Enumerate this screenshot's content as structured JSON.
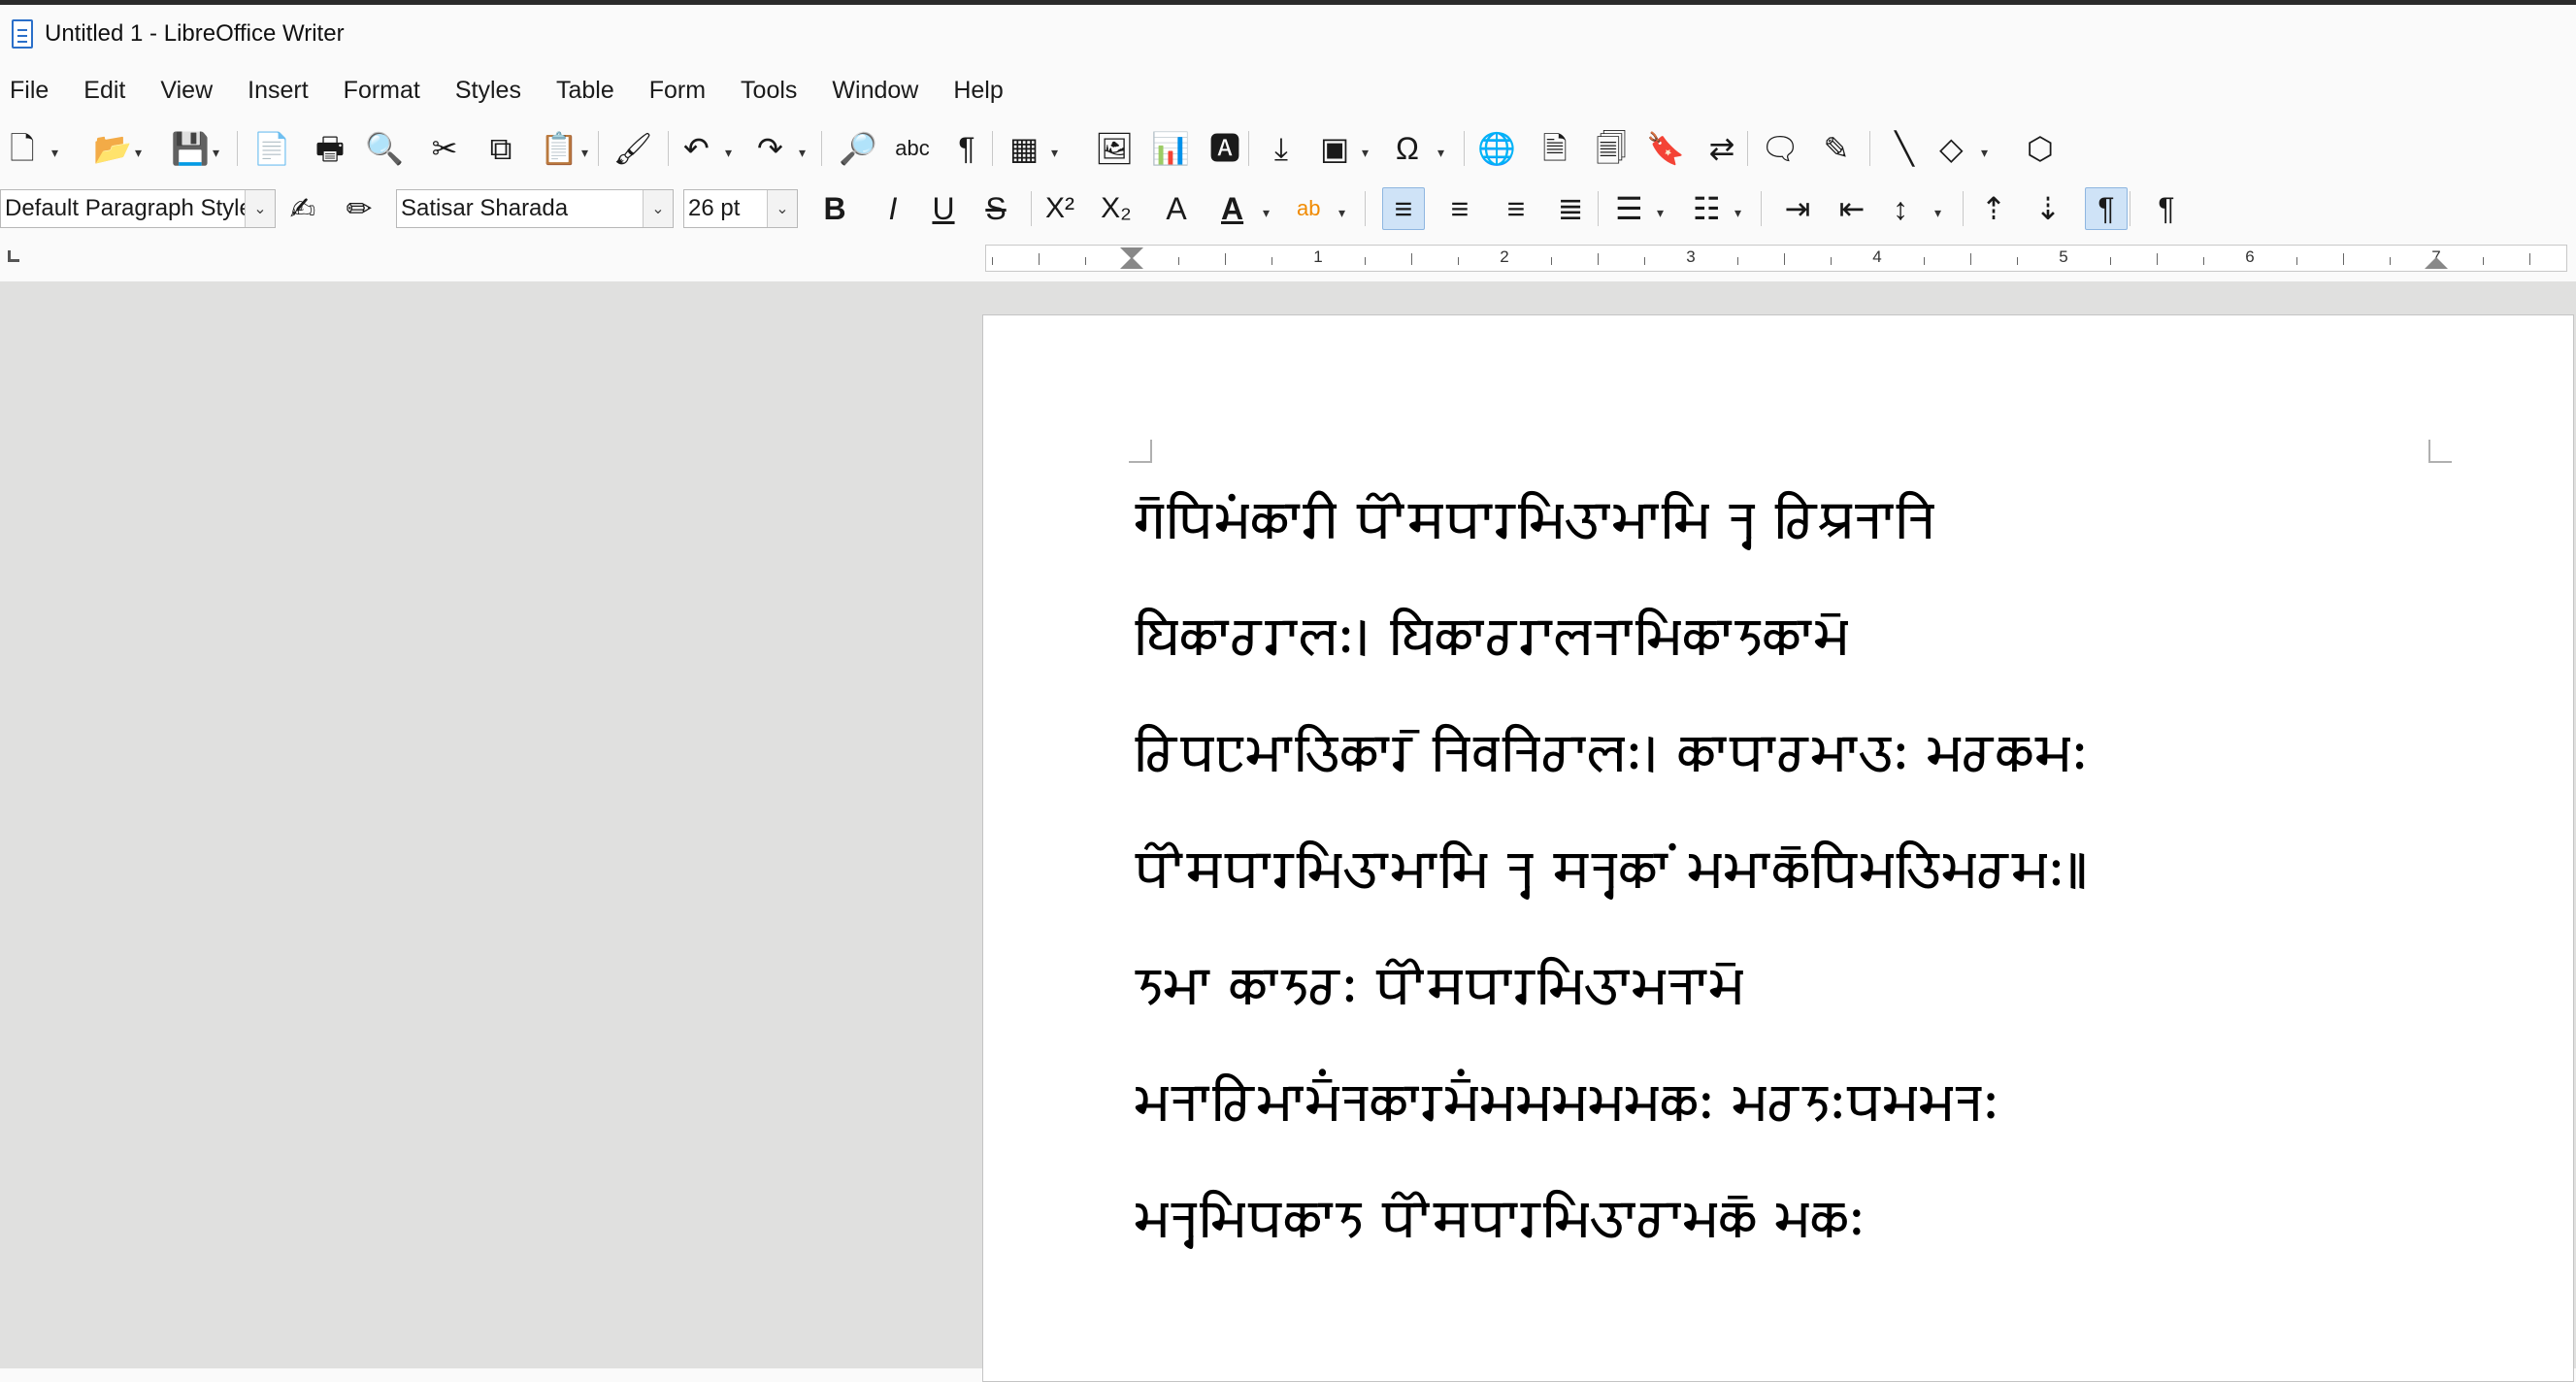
{
  "window": {
    "title": "Untitled 1 - LibreOffice Writer",
    "app_icon": "writer-document-icon"
  },
  "menu": [
    "File",
    "Edit",
    "View",
    "Insert",
    "Format",
    "Styles",
    "Table",
    "Form",
    "Tools",
    "Window",
    "Help"
  ],
  "toolbar1": [
    {
      "name": "new-document",
      "icon": "new-document-icon",
      "glyph": "🗋",
      "dropdown": true
    },
    {
      "name": "open",
      "icon": "folder-open-icon",
      "glyph": "📂",
      "dropdown": true
    },
    {
      "name": "save",
      "icon": "save-icon",
      "glyph": "💾",
      "dropdown": true
    },
    {
      "name": "export-pdf",
      "icon": "pdf-export-icon",
      "glyph": "📄",
      "dropdown": false
    },
    {
      "name": "print",
      "icon": "printer-icon",
      "glyph": "🖶",
      "dropdown": false
    },
    {
      "name": "print-preview",
      "icon": "print-preview-icon",
      "glyph": "🔍",
      "dropdown": false
    },
    {
      "name": "cut",
      "icon": "scissors-icon",
      "glyph": "✂",
      "dropdown": false
    },
    {
      "name": "copy",
      "icon": "copy-icon",
      "glyph": "⧉",
      "dropdown": false
    },
    {
      "name": "paste",
      "icon": "clipboard-icon",
      "glyph": "📋",
      "dropdown": true
    },
    {
      "name": "clone-formatting",
      "icon": "paintbrush-icon",
      "glyph": "🖌",
      "dropdown": false
    },
    {
      "name": "undo",
      "icon": "undo-icon",
      "glyph": "↶",
      "dropdown": true
    },
    {
      "name": "redo",
      "icon": "redo-icon",
      "glyph": "↷",
      "dropdown": true
    },
    {
      "name": "find-replace",
      "icon": "find-replace-icon",
      "glyph": "🔎",
      "dropdown": false
    },
    {
      "name": "spelling",
      "icon": "spellcheck-icon",
      "glyph": "abc",
      "dropdown": false
    },
    {
      "name": "formatting-marks",
      "icon": "pilcrow-icon",
      "glyph": "¶",
      "dropdown": false
    },
    {
      "name": "insert-table",
      "icon": "table-icon",
      "glyph": "▦",
      "dropdown": true
    },
    {
      "name": "insert-image",
      "icon": "image-icon",
      "glyph": "🖼",
      "dropdown": false
    },
    {
      "name": "insert-chart",
      "icon": "chart-icon",
      "glyph": "📊",
      "dropdown": false
    },
    {
      "name": "insert-textbox",
      "icon": "textbox-icon",
      "glyph": "🅰",
      "dropdown": false
    },
    {
      "name": "page-break",
      "icon": "page-break-icon",
      "glyph": "⤓",
      "dropdown": false
    },
    {
      "name": "insert-field",
      "icon": "field-icon",
      "glyph": "▣",
      "dropdown": true
    },
    {
      "name": "special-character",
      "icon": "omega-icon",
      "glyph": "Ω",
      "dropdown": true
    },
    {
      "name": "hyperlink",
      "icon": "globe-link-icon",
      "glyph": "🌐",
      "dropdown": false
    },
    {
      "name": "footnote",
      "icon": "footnote-icon",
      "glyph": "🗎",
      "dropdown": false
    },
    {
      "name": "endnote",
      "icon": "endnote-icon",
      "glyph": "🗐",
      "dropdown": false
    },
    {
      "name": "bookmark",
      "icon": "bookmark-icon",
      "glyph": "🔖",
      "dropdown": false
    },
    {
      "name": "cross-reference",
      "icon": "cross-reference-icon",
      "glyph": "⇄",
      "dropdown": false
    },
    {
      "name": "comment",
      "icon": "comment-icon",
      "glyph": "🗨",
      "dropdown": false
    },
    {
      "name": "track-changes",
      "icon": "track-changes-icon",
      "glyph": "✎",
      "dropdown": false
    },
    {
      "name": "line",
      "icon": "line-icon",
      "glyph": "╲",
      "dropdown": false
    },
    {
      "name": "basic-shapes",
      "icon": "diamond-icon",
      "glyph": "◇",
      "dropdown": true
    },
    {
      "name": "draw-functions",
      "icon": "shapes-icon",
      "glyph": "⬡",
      "dropdown": false
    }
  ],
  "paragraph_style": "Default Paragraph Style",
  "font_name": "Satisar Sharada",
  "font_size": "26 pt",
  "toolbar2": [
    {
      "name": "update-style",
      "icon": "update-style-icon",
      "glyph": "✍",
      "dropdown": false
    },
    {
      "name": "new-style",
      "icon": "new-style-icon",
      "glyph": "✏",
      "dropdown": false
    },
    {
      "name": "bold",
      "icon": "bold-icon",
      "glyph": "B",
      "dropdown": false
    },
    {
      "name": "italic",
      "icon": "italic-icon",
      "glyph": "I",
      "dropdown": false
    },
    {
      "name": "underline",
      "icon": "underline-icon",
      "glyph": "U",
      "dropdown": false
    },
    {
      "name": "strikethrough",
      "icon": "strikethrough-icon",
      "glyph": "S",
      "dropdown": false
    },
    {
      "name": "superscript",
      "icon": "superscript-icon",
      "glyph": "X²",
      "dropdown": false
    },
    {
      "name": "subscript",
      "icon": "subscript-icon",
      "glyph": "X₂",
      "dropdown": false
    },
    {
      "name": "clear-formatting",
      "icon": "eraser-icon",
      "glyph": "A",
      "dropdown": false
    },
    {
      "name": "font-color",
      "icon": "font-color-icon",
      "glyph": "A",
      "dropdown": true
    },
    {
      "name": "highlighting",
      "icon": "highlighter-icon",
      "glyph": "ab",
      "dropdown": true
    },
    {
      "name": "align-left",
      "icon": "align-left-icon",
      "glyph": "≡",
      "dropdown": false,
      "active": true
    },
    {
      "name": "align-center",
      "icon": "align-center-icon",
      "glyph": "≡",
      "dropdown": false
    },
    {
      "name": "align-right",
      "icon": "align-right-icon",
      "glyph": "≡",
      "dropdown": false
    },
    {
      "name": "justify",
      "icon": "justify-icon",
      "glyph": "≣",
      "dropdown": false
    },
    {
      "name": "bullets",
      "icon": "bullet-list-icon",
      "glyph": "☰",
      "dropdown": true
    },
    {
      "name": "numbering",
      "icon": "numbered-list-icon",
      "glyph": "☷",
      "dropdown": true
    },
    {
      "name": "increase-indent",
      "icon": "increase-indent-icon",
      "glyph": "⇥",
      "dropdown": false
    },
    {
      "name": "decrease-indent",
      "icon": "decrease-indent-icon",
      "glyph": "⇤",
      "dropdown": false
    },
    {
      "name": "line-spacing",
      "icon": "line-spacing-icon",
      "glyph": "↕",
      "dropdown": true
    },
    {
      "name": "increase-paragraph-spacing",
      "icon": "paragraph-spacing-increase-icon",
      "glyph": "⇡",
      "dropdown": false
    },
    {
      "name": "decrease-paragraph-spacing",
      "icon": "paragraph-spacing-decrease-icon",
      "glyph": "⇣",
      "dropdown": false
    },
    {
      "name": "ltr",
      "icon": "left-to-right-icon",
      "glyph": "¶",
      "dropdown": false,
      "active": true
    },
    {
      "name": "rtl",
      "icon": "right-to-left-icon",
      "glyph": "¶",
      "dropdown": false
    }
  ],
  "ruler_numbers": [
    "1",
    "2",
    "3",
    "4",
    "5",
    "6",
    "7"
  ],
  "document_lines": [
    "𑆓𑆼𑆥𑆴𑆩𑆁𑆑𑆳𑆫𑆵 𑆥𑆿𑆯𑆥𑆳𑆫𑆩𑆴𑆠𑆳𑆩𑆳𑆱𑆴 𑆤𑆶 𑆧𑆴𑆃𑆤𑆳𑆤𑆴",
    "𑆪𑆴𑆑𑆳𑆧𑆫𑆳𑆬𑆂𑇅 𑆪𑆴𑆑𑆳𑆧𑆫𑆳𑆬𑆤𑆳𑆩𑆴𑆑𑆳𑆝𑆑𑆳𑆩𑆼",
    "𑆧𑆴𑆥𑆛𑆩𑆳𑆠𑆴𑆑𑆳𑆫𑆼 𑆤𑆴𑆮𑆤𑆴𑆧𑆳𑆬𑆂𑇅 𑆑𑆳𑆥𑆳𑆧𑆩𑆳𑆠𑆂 𑆩𑆧𑆑𑆱𑆂",
    "𑆥𑆿𑆯𑆥𑆳𑆫𑆩𑆴𑆠𑆳𑆩𑆳𑆱𑆴 𑆤𑆶 𑆯𑆤𑆶𑆑𑆳𑆁 𑆩𑆩𑆳𑆑𑆼𑆥𑆴𑆩𑆠𑆴𑆩𑆧𑆱𑆂𑇆",
    "𑆝𑆩𑆳 𑆑𑆳𑆝𑆧𑆂 𑆥𑆿𑆯𑆥𑆳𑆫𑆩𑆴𑆠𑆳𑆩𑆤𑆳𑆩𑆼",
    "𑆩𑆤𑆳𑆧𑆴𑆩𑆳𑆩𑆼𑆁𑆤𑆑𑆳𑆫𑆩𑆼𑆁𑆩𑆩𑆩𑆩𑆩𑆑𑆂 𑆩𑆧𑆝𑆂𑆥𑆩𑆩𑆤𑆂",
    "𑆩𑆤𑆶𑆩𑆴𑆥𑆑𑆳𑆝 𑆥𑆿𑆯𑆥𑆳𑆫𑆩𑆴𑆠𑆳𑆧𑆳𑆩𑆑𑆼 𑆩𑆑𑆂"
  ]
}
